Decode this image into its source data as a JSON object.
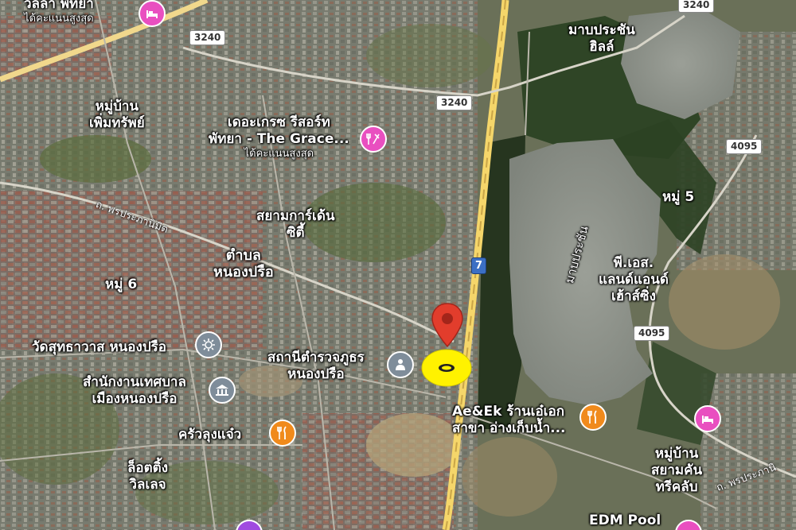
{
  "map": {
    "labels": {
      "villa_top": "วิลล่า พัทยา",
      "villa_top_sub": "ได้คะแนนสูงสุด",
      "mooban_permsap_1": "หมู่บ้าน",
      "mooban_permsap_2": "เพิ่มทรัพย์",
      "grace_1": "เดอะเกรซ รีสอร์ท",
      "grace_2": "พัทยา - The Grace...",
      "grace_sub": "ได้คะแนนสูงสุด",
      "siam_garden_1": "สยามการ์เด้น",
      "siam_garden_2": "ซิตี้",
      "tambon_1": "ตำบล",
      "tambon_2": "หนองปรือ",
      "moo6": "หมู่ 6",
      "wat": "วัดสุทธาวาส หนองปรือ",
      "police_1": "สถานีตำรวจภูธร",
      "police_2": "หนองปรือ",
      "municipal_1": "สำนักงานเทศบาล",
      "municipal_2": "เมืองหนองปรือ",
      "krua": "ครัวลุงแจ๋ว",
      "aek_1": "Ae&Ek ร้านเอ๋เอก",
      "aek_2": "สาขา อ่างเก็บน้ำ...",
      "lotting_1": "ล็อตติ้ง",
      "lotting_2": "วิลเลจ",
      "mabprachan_hills_1": "มาบประชัน",
      "mabprachan_hills_2": "ฮิลล์",
      "moo5": "หมู่ 5",
      "ps_land_1": "พี.เอส.",
      "ps_land_2": "แลนด์แอนด์",
      "ps_land_3": "เฮ้าส์ซิ่ง",
      "siam_country_1": "หมู่บ้าน",
      "siam_country_2": "สยามคัน",
      "siam_country_3": "ทรีคลับ",
      "edm_pool": "EDM Pool",
      "lake": "มาบประชัน",
      "road_pornprapa_left": "ถ. พรประภานิมิต",
      "road_pornprapa_right": "ถ. พรประภานิ"
    },
    "shields": {
      "r3240_a": "3240",
      "r3240_b": "3240",
      "r3240_c": "3240",
      "r4095_a": "4095",
      "r4095_b": "4095",
      "hwy7": "7"
    },
    "icons": {
      "hotel": "bed-icon",
      "resort": "utensils-pool-icon",
      "temple": "temple-icon",
      "government": "government-building-icon",
      "police": "police-icon",
      "restaurant": "restaurant-icon",
      "marker": "location-pin-icon",
      "highlight": "yellow-highlight-marker"
    },
    "colors": {
      "marker_red": "#e23d2c",
      "highlight_yellow": "#fff200",
      "pin_pink": "#e94fc0",
      "pin_orange": "#f08a1c",
      "pin_gray": "#7f8d9a",
      "road_yellow": "#f5d66a"
    }
  }
}
